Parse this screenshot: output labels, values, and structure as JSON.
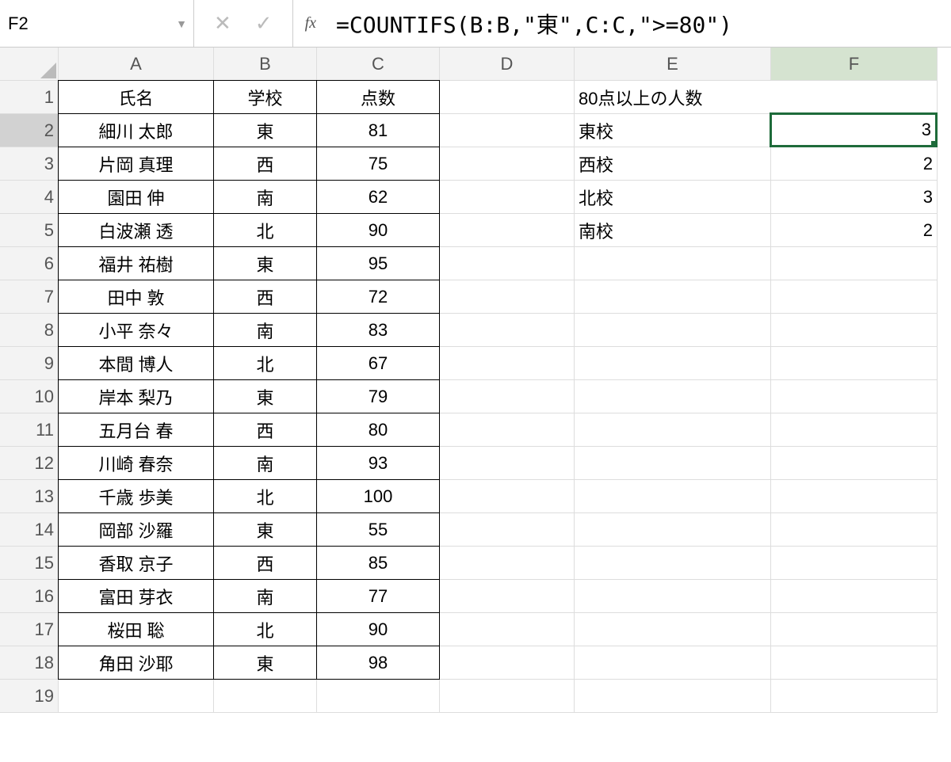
{
  "namebox": "F2",
  "fx": "fx",
  "formula": "=COUNTIFS(B:B,\"東\",C:C,\">=80\")",
  "columns": [
    "A",
    "B",
    "C",
    "D",
    "E",
    "F"
  ],
  "rows": [
    "1",
    "2",
    "3",
    "4",
    "5",
    "6",
    "7",
    "8",
    "9",
    "10",
    "11",
    "12",
    "13",
    "14",
    "15",
    "16",
    "17",
    "18",
    "19"
  ],
  "headers": {
    "A": "氏名",
    "B": "学校",
    "C": "点数"
  },
  "data": [
    {
      "name": "細川 太郎",
      "school": "東",
      "score": "81"
    },
    {
      "name": "片岡 真理",
      "school": "西",
      "score": "75"
    },
    {
      "name": "園田 伸",
      "school": "南",
      "score": "62"
    },
    {
      "name": "白波瀬 透",
      "school": "北",
      "score": "90"
    },
    {
      "name": "福井 祐樹",
      "school": "東",
      "score": "95"
    },
    {
      "name": "田中 敦",
      "school": "西",
      "score": "72"
    },
    {
      "name": "小平 奈々",
      "school": "南",
      "score": "83"
    },
    {
      "name": "本間 博人",
      "school": "北",
      "score": "67"
    },
    {
      "name": "岸本 梨乃",
      "school": "東",
      "score": "79"
    },
    {
      "name": "五月台 春",
      "school": "西",
      "score": "80"
    },
    {
      "name": "川崎 春奈",
      "school": "南",
      "score": "93"
    },
    {
      "name": "千歳 歩美",
      "school": "北",
      "score": "100"
    },
    {
      "name": "岡部 沙羅",
      "school": "東",
      "score": "55"
    },
    {
      "name": "香取 京子",
      "school": "西",
      "score": "85"
    },
    {
      "name": "富田 芽衣",
      "school": "南",
      "score": "77"
    },
    {
      "name": "桜田 聡",
      "school": "北",
      "score": "90"
    },
    {
      "name": "角田 沙耶",
      "school": "東",
      "score": "98"
    }
  ],
  "summary_title": "80点以上の人数",
  "summary": [
    {
      "label": "東校",
      "value": "3"
    },
    {
      "label": "西校",
      "value": "2"
    },
    {
      "label": "北校",
      "value": "3"
    },
    {
      "label": "南校",
      "value": "2"
    }
  ]
}
